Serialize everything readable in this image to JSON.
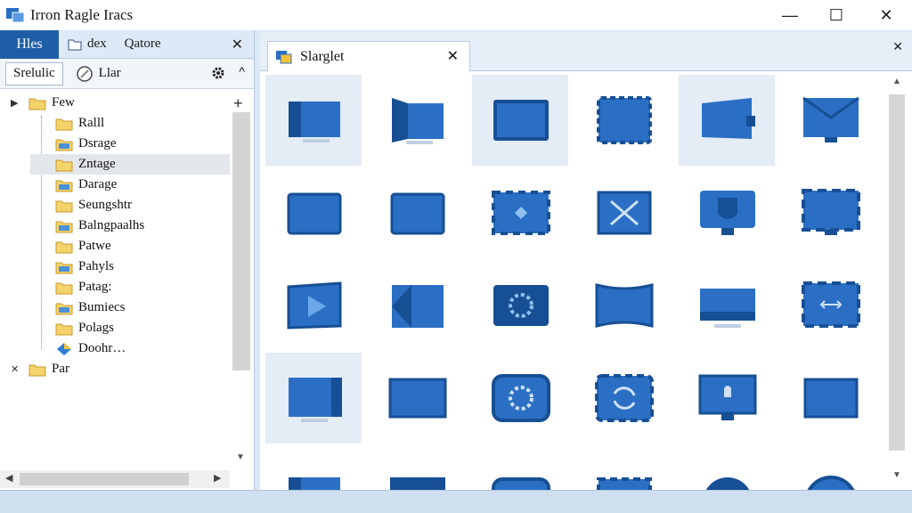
{
  "window": {
    "title": "Irron Ragle Iracs",
    "controls": {
      "minimize": "—",
      "maximize": "☐",
      "close": "✕"
    }
  },
  "left_panel": {
    "tabs": [
      {
        "label": "Hles",
        "active": true
      },
      {
        "label": "dex",
        "active": false
      },
      {
        "label": "Qatore",
        "active": false
      }
    ],
    "close": "✕",
    "toolbar": {
      "button": "Srelulic",
      "item": "Llar",
      "collapse": "^"
    },
    "tree": [
      {
        "label": "Few",
        "depth": 0,
        "arrow": "▶"
      },
      {
        "label": "Ralll",
        "depth": 1
      },
      {
        "label": "Dsrage",
        "depth": 1
      },
      {
        "label": "Zntage",
        "depth": 1,
        "selected": true
      },
      {
        "label": "Darage",
        "depth": 1
      },
      {
        "label": "Seungshtr",
        "depth": 1
      },
      {
        "label": "Balngpaalhs",
        "depth": 1
      },
      {
        "label": "Patwe",
        "depth": 1
      },
      {
        "label": "Pahyls",
        "depth": 1
      },
      {
        "label": "Patag:",
        "depth": 1
      },
      {
        "label": "Bumiecs",
        "depth": 1
      },
      {
        "label": "Polags",
        "depth": 1
      },
      {
        "label": "Doohr…",
        "depth": 1
      },
      {
        "label": "Par",
        "depth": 0,
        "arrow": "✕"
      }
    ],
    "add": "+"
  },
  "right_panel": {
    "tab_label": "Slarglet",
    "tab_close": "✕",
    "panel_close": "✕",
    "icons": [
      "monitor-left-icon",
      "monitor-side-icon",
      "monitor-screen-icon",
      "chip-screen-icon",
      "monitor-tilt-icon",
      "monitor-stand-icon",
      "panel-icon",
      "panel-side-icon",
      "pinned-frame-icon",
      "x-frame-icon",
      "monitor-u-icon",
      "monitor-frame-icon",
      "play-monitor-icon",
      "split-screen-icon",
      "gear-screen-icon",
      "curved-frame-icon",
      "flat-monitor-icon",
      "arrows-frame-icon",
      "wide-monitor-icon",
      "flat-panel-icon",
      "cog-screen-icon",
      "refresh-frame-icon",
      "bulb-monitor-icon",
      "plain-panel-icon",
      "partial-monitor-icon",
      "partial-panel-icon",
      "partial-dial-icon",
      "partial-chart-icon",
      "partial-compass-icon",
      "partial-compass-icon"
    ],
    "highlighted": [
      0,
      2,
      4,
      18
    ]
  },
  "colors": {
    "accent": "#1f5ea6",
    "icon": "#2a6fc4",
    "icon_dark": "#174f94"
  }
}
